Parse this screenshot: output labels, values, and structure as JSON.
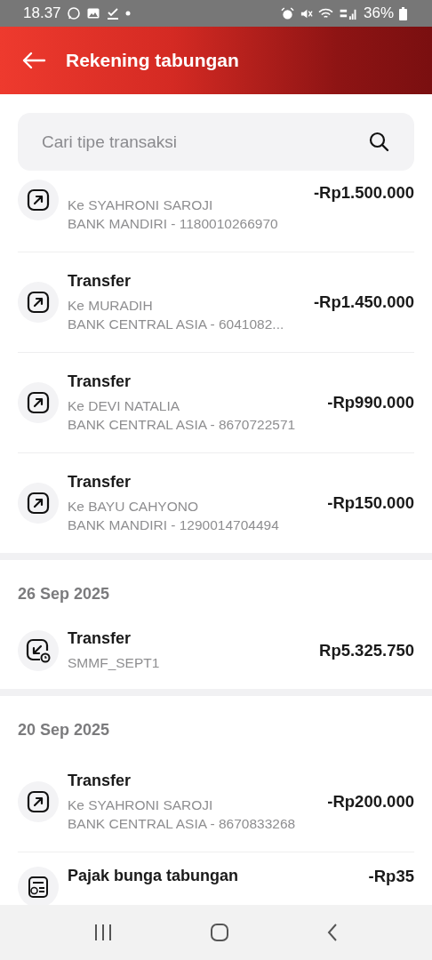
{
  "status_bar": {
    "time": "18.37",
    "battery": "36%"
  },
  "header": {
    "title": "Rekening tabungan"
  },
  "search": {
    "placeholder": "Cari tipe transaksi"
  },
  "sections": [
    {
      "items": [
        {
          "kind": "out",
          "lines": [
            "Ke SYAHRONI SAROJI",
            "BANK MANDIRI - 1180010266970"
          ],
          "amount": "-Rp1.500.000"
        },
        {
          "kind": "out",
          "title": "Transfer",
          "lines": [
            "Ke MURADIH",
            "BANK CENTRAL ASIA - 6041082..."
          ],
          "amount": "-Rp1.450.000"
        },
        {
          "kind": "out",
          "title": "Transfer",
          "lines": [
            "Ke DEVI NATALIA",
            "BANK CENTRAL ASIA - 8670722571"
          ],
          "amount": "-Rp990.000"
        },
        {
          "kind": "out",
          "title": "Transfer",
          "lines": [
            "Ke BAYU CAHYONO",
            "BANK MANDIRI - 1290014704494"
          ],
          "amount": "-Rp150.000"
        }
      ]
    },
    {
      "date": "26 Sep 2025",
      "items": [
        {
          "kind": "in",
          "title": "Transfer",
          "lines": [
            "SMMF_SEPT1"
          ],
          "amount": "Rp5.325.750"
        }
      ]
    },
    {
      "date": "20 Sep 2025",
      "items": [
        {
          "kind": "out",
          "title": "Transfer",
          "lines": [
            "Ke SYAHRONI SAROJI",
            "BANK CENTRAL ASIA - 8670833268"
          ],
          "amount": "-Rp200.000"
        },
        {
          "kind": "tax",
          "title": "Pajak bunga tabungan",
          "amount": "-Rp35"
        }
      ]
    }
  ]
}
